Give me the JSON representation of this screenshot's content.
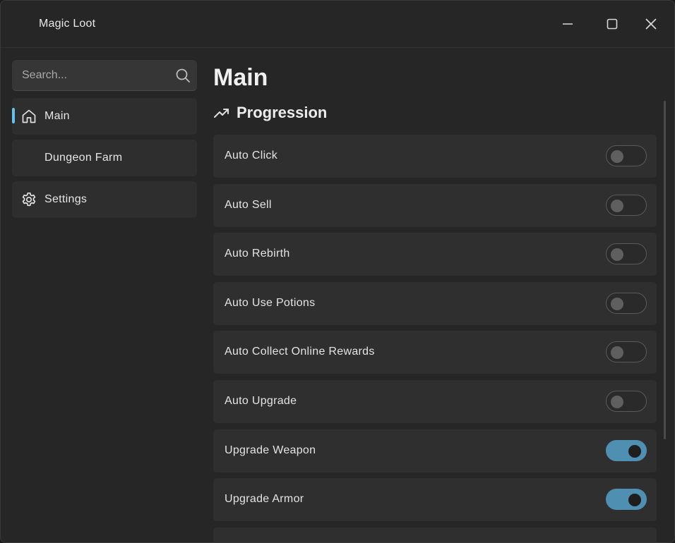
{
  "window": {
    "title": "Magic Loot",
    "controls": [
      "minimize-icon",
      "maximize-icon",
      "close-icon"
    ]
  },
  "sidebar": {
    "search": {
      "placeholder": "Search..."
    },
    "items": [
      {
        "label": "Main",
        "icon": "home-icon",
        "active": true
      },
      {
        "label": "Dungeon Farm",
        "icon": "",
        "active": false
      },
      {
        "label": "Settings",
        "icon": "gear-icon",
        "active": false
      }
    ]
  },
  "main": {
    "title": "Main",
    "section": {
      "label": "Progression",
      "icon": "trending-up-icon"
    },
    "toggles": [
      {
        "label": "Auto Click",
        "on": false
      },
      {
        "label": "Auto Sell",
        "on": false
      },
      {
        "label": "Auto Rebirth",
        "on": false
      },
      {
        "label": "Auto Use Potions",
        "on": false
      },
      {
        "label": "Auto Collect Online Rewards",
        "on": false
      },
      {
        "label": "Auto Upgrade",
        "on": false
      },
      {
        "label": "Upgrade Weapon",
        "on": true
      },
      {
        "label": "Upgrade Armor",
        "on": true
      }
    ]
  },
  "colors": {
    "accent": "#60c3f0",
    "toggle_on": "#4f8fb1",
    "background": "#262626",
    "row": "#2f2f2f"
  }
}
